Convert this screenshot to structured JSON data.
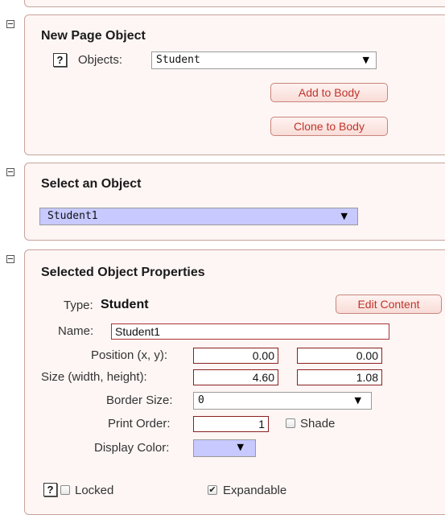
{
  "new_page_object": {
    "title": "New Page Object",
    "objects_label": "Objects:",
    "objects_value": "Student",
    "add_button": "Add to Body",
    "clone_button": "Clone to Body"
  },
  "select_object": {
    "title": "Select an Object",
    "selected": "Student1"
  },
  "properties": {
    "title": "Selected Object Properties",
    "type_label": "Type:",
    "type_value": "Student",
    "edit_button": "Edit Content",
    "name_label": "Name:",
    "name_value": "Student1",
    "position_label": "Position (x, y):",
    "position_x": "0.00",
    "position_y": "0.00",
    "size_label": "Size (width, height):",
    "size_width": "4.60",
    "size_height": "1.08",
    "border_label": "Border Size:",
    "border_value": "0",
    "print_order_label": "Print Order:",
    "print_order_value": "1",
    "shade_label": "Shade",
    "display_color_label": "Display Color:",
    "display_color": "#c7c9ff",
    "locked_label": "Locked",
    "expandable_label": "Expandable"
  },
  "icons": {
    "help": "?",
    "dropdown_arrow": "▼",
    "check": "✔"
  }
}
